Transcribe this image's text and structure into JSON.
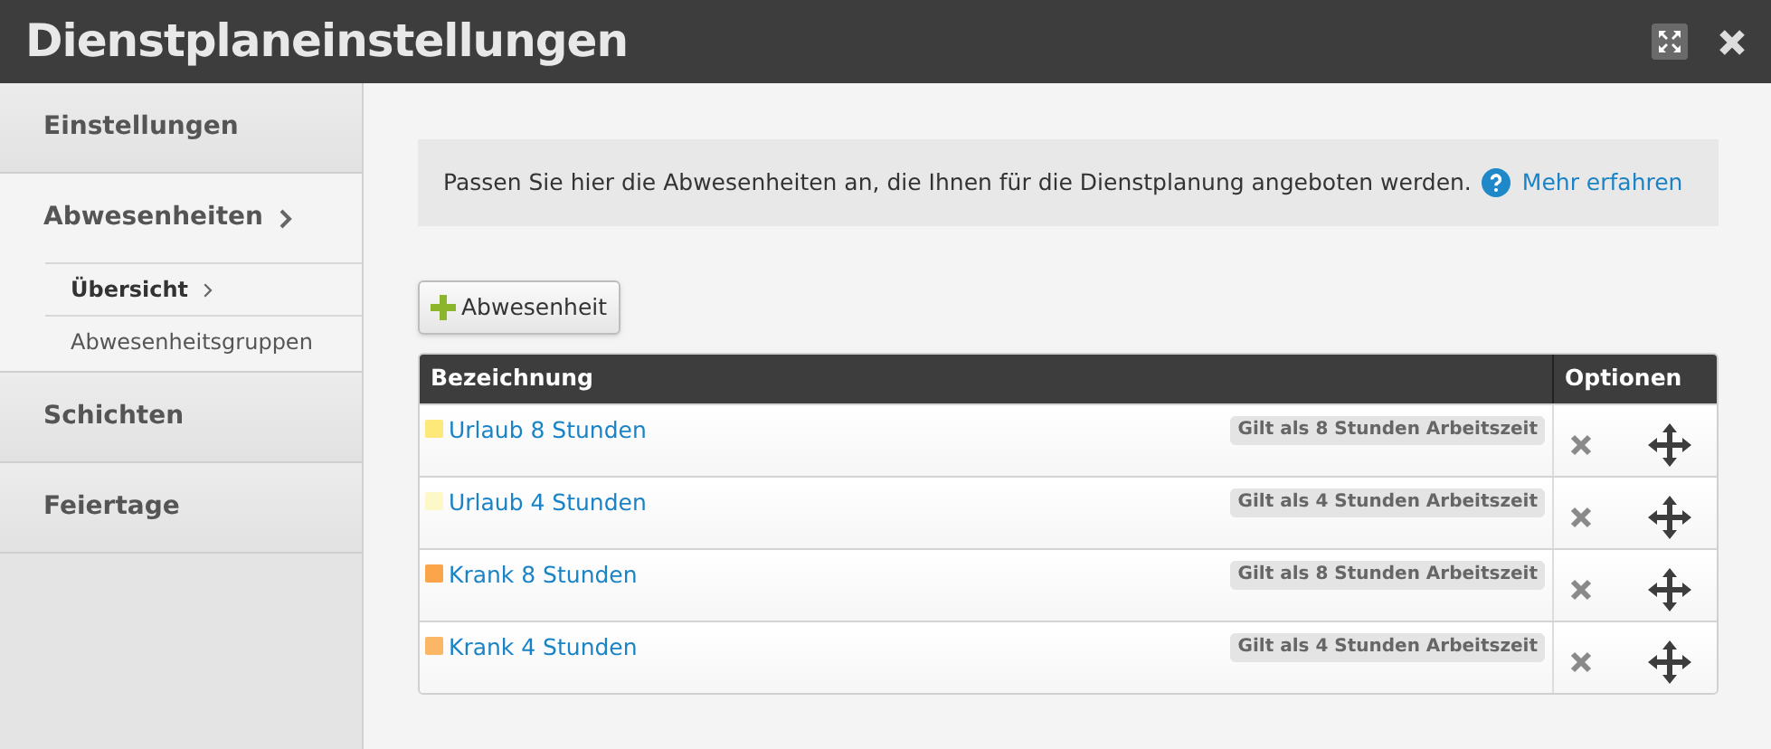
{
  "window": {
    "title": "Dienstplaneinstellungen"
  },
  "sidebar": {
    "items": [
      {
        "label": "Einstellungen",
        "selected": false,
        "expanded": false
      },
      {
        "label": "Abwesenheiten",
        "selected": true,
        "expanded": true,
        "children": [
          {
            "label": "Übersicht",
            "selected": true
          },
          {
            "label": "Abwesenheitsgruppen",
            "selected": false
          }
        ]
      },
      {
        "label": "Schichten",
        "selected": false,
        "expanded": false
      },
      {
        "label": "Feiertage",
        "selected": false,
        "expanded": false
      }
    ]
  },
  "info": {
    "text": "Passen Sie hier die Abwesenheiten an, die Ihnen für die Dienstplanung angeboten werden.",
    "link": "Mehr erfahren"
  },
  "add_button": {
    "label": "Abwesenheit"
  },
  "table": {
    "columns": [
      "Bezeichnung",
      "Optionen"
    ],
    "rows": [
      {
        "name": "Urlaub 8 Stunden",
        "color": "#fde87a",
        "badge": "Gilt als 8 Stunden Arbeitszeit"
      },
      {
        "name": "Urlaub 4 Stunden",
        "color": "#fdf8c8",
        "badge": "Gilt als 4 Stunden Arbeitszeit"
      },
      {
        "name": "Krank 8 Stunden",
        "color": "#fba54a",
        "badge": "Gilt als 8 Stunden Arbeitszeit"
      },
      {
        "name": "Krank 4 Stunden",
        "color": "#fcb766",
        "badge": "Gilt als 4 Stunden Arbeitszeit"
      }
    ]
  }
}
